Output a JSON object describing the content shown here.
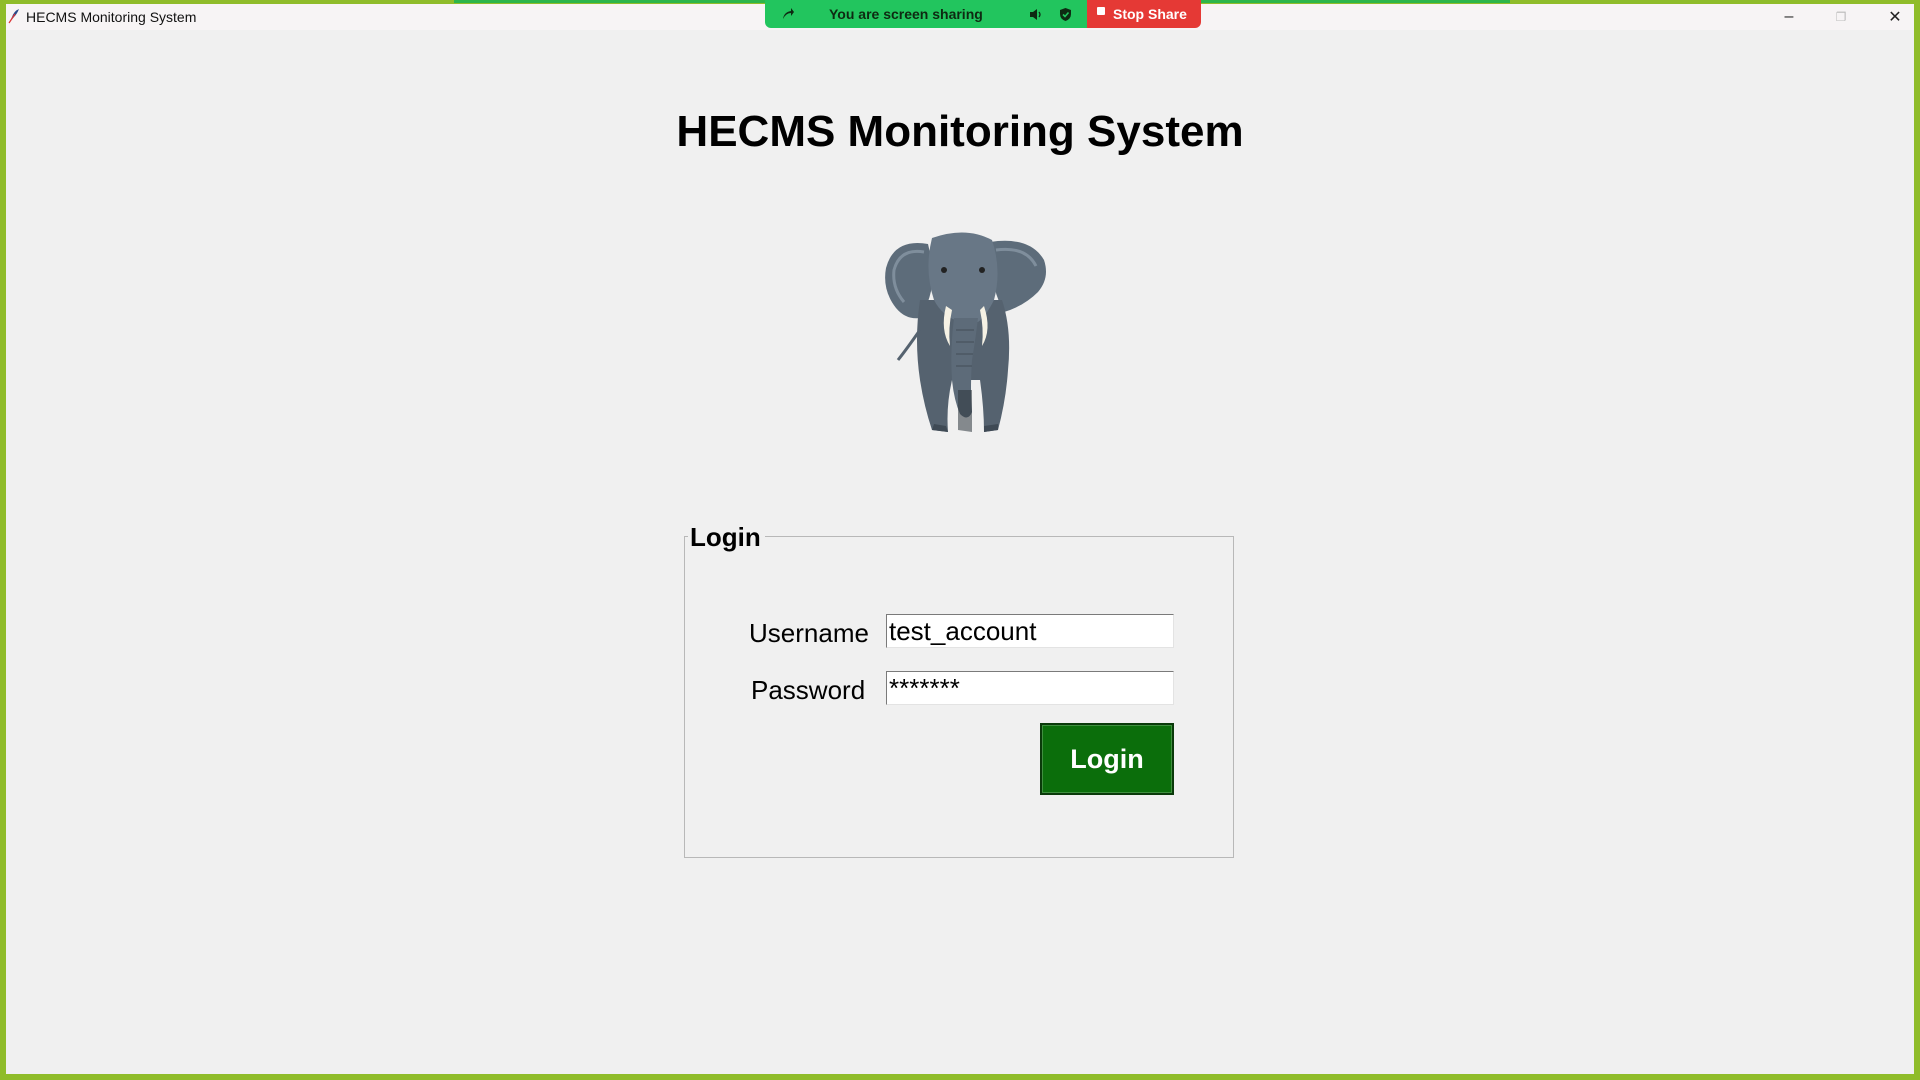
{
  "window": {
    "title": "HECMS Monitoring System",
    "minimize_label": "–",
    "maximize_label": "❐",
    "close_label": "✕"
  },
  "screen_share": {
    "status_text": "You are screen sharing",
    "stop_label": "Stop Share"
  },
  "page": {
    "heading": "HECMS Monitoring System"
  },
  "login": {
    "legend": "Login",
    "username_label": "Username",
    "username_value": "test_account",
    "password_label": "Password",
    "password_value": "*******",
    "submit_label": "Login"
  },
  "colors": {
    "screen_border": "#8fbc2a",
    "share_green": "#22c55e",
    "share_red": "#e53935",
    "login_button": "#0b6e0b"
  }
}
